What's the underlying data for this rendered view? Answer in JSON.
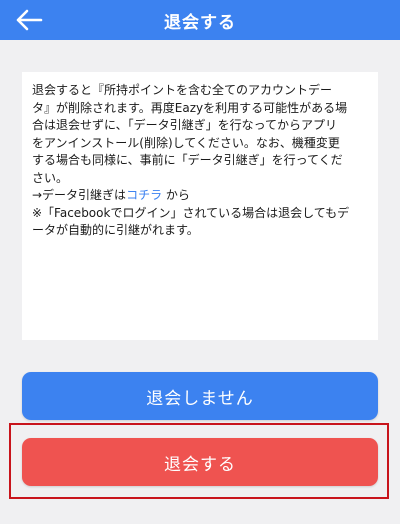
{
  "header": {
    "title": "退会する",
    "back_icon": "arrow-left-icon",
    "color": "#3c82f0"
  },
  "notice": {
    "lines": [
      "退会すると『所持ポイントを含む全てのアカウントデー",
      "タ』が削除されます。再度Eazyを利用する可能性がある場",
      "合は退会せずに、「データ引継ぎ」を行なってからアプリ",
      "をアンインストール(削除)してください。なお、機種変更",
      "する場合も同様に、事前に「データ引継ぎ」を行ってくだ",
      "さい。"
    ],
    "transfer_prefix": "→データ引継ぎは",
    "transfer_link": "コチラ",
    "transfer_suffix": " から",
    "facebook_lines": [
      "※「Facebookでログイン」されている場合は退会してもデ",
      "ータが自動的に引継がれます。"
    ],
    "link_color": "#3c82f0"
  },
  "buttons": {
    "keep_label": "退会しません",
    "keep_color": "#3c82f0",
    "withdraw_label": "退会する",
    "withdraw_color": "#ef5350"
  },
  "highlight": {
    "color": "#c8141c"
  }
}
